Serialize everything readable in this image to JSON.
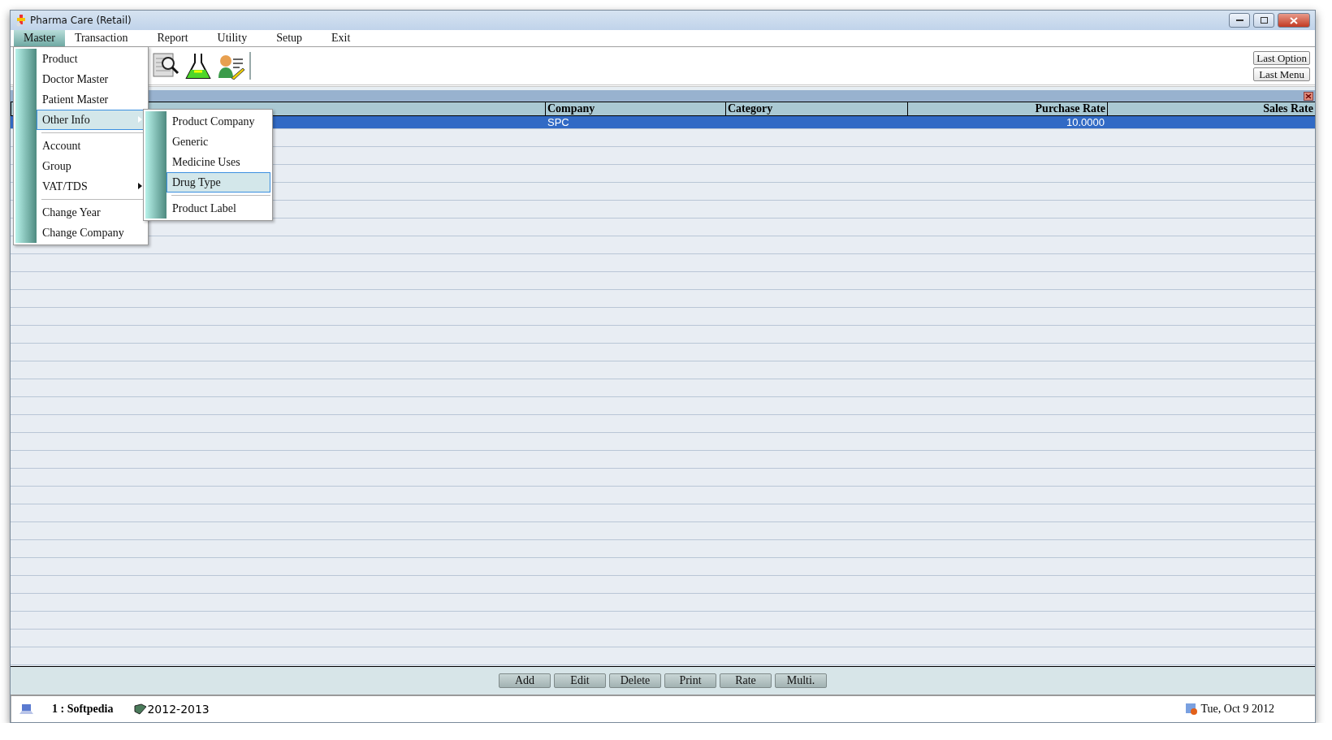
{
  "window": {
    "title": "Pharma Care (Retail)"
  },
  "menu_bar": [
    {
      "label": "Master",
      "selected": true
    },
    {
      "label": "Transaction",
      "selected": false
    },
    {
      "label": "Report",
      "selected": false
    },
    {
      "label": "Utility",
      "selected": false
    },
    {
      "label": "Setup",
      "selected": false
    },
    {
      "label": "Exit",
      "selected": false
    }
  ],
  "master_menu": [
    {
      "kind": "item",
      "label": "Product",
      "selected": false,
      "submenu": false
    },
    {
      "kind": "item",
      "label": "Doctor Master",
      "selected": false,
      "submenu": false
    },
    {
      "kind": "item",
      "label": "Patient Master",
      "selected": false,
      "submenu": false
    },
    {
      "kind": "item",
      "label": "Other Info",
      "selected": true,
      "submenu": true
    },
    {
      "kind": "separator"
    },
    {
      "kind": "item",
      "label": "Account",
      "selected": false,
      "submenu": false
    },
    {
      "kind": "item",
      "label": "Group",
      "selected": false,
      "submenu": false
    },
    {
      "kind": "item",
      "label": "VAT/TDS",
      "selected": false,
      "submenu": true
    },
    {
      "kind": "separator"
    },
    {
      "kind": "item",
      "label": "Change Year",
      "selected": false,
      "submenu": false
    },
    {
      "kind": "item",
      "label": "Change Company",
      "selected": false,
      "submenu": false
    }
  ],
  "other_info_menu": [
    {
      "kind": "item",
      "label": "Product Company",
      "selected": false
    },
    {
      "kind": "item",
      "label": "Generic",
      "selected": false
    },
    {
      "kind": "item",
      "label": "Medicine Uses",
      "selected": false
    },
    {
      "kind": "item",
      "label": "Drug Type",
      "selected": true
    },
    {
      "kind": "separator"
    },
    {
      "kind": "item",
      "label": "Product Label",
      "selected": false
    }
  ],
  "toolbar": {
    "right_buttons": [
      "Last Option",
      "Last Menu"
    ]
  },
  "table": {
    "columns": [
      "",
      "Company",
      "Category",
      "Purchase Rate",
      "Sales Rate"
    ],
    "rows": [
      {
        "cells": [
          "",
          "SPC",
          "",
          "10.0000",
          ""
        ],
        "selected": true
      }
    ]
  },
  "action_buttons": [
    "Add",
    "Edit",
    "Delete",
    "Print",
    "Rate",
    "Multi."
  ],
  "status_bar": {
    "company": "1 : Softpedia",
    "year": "2012-2013",
    "date": "Tue, Oct 9 2012"
  }
}
